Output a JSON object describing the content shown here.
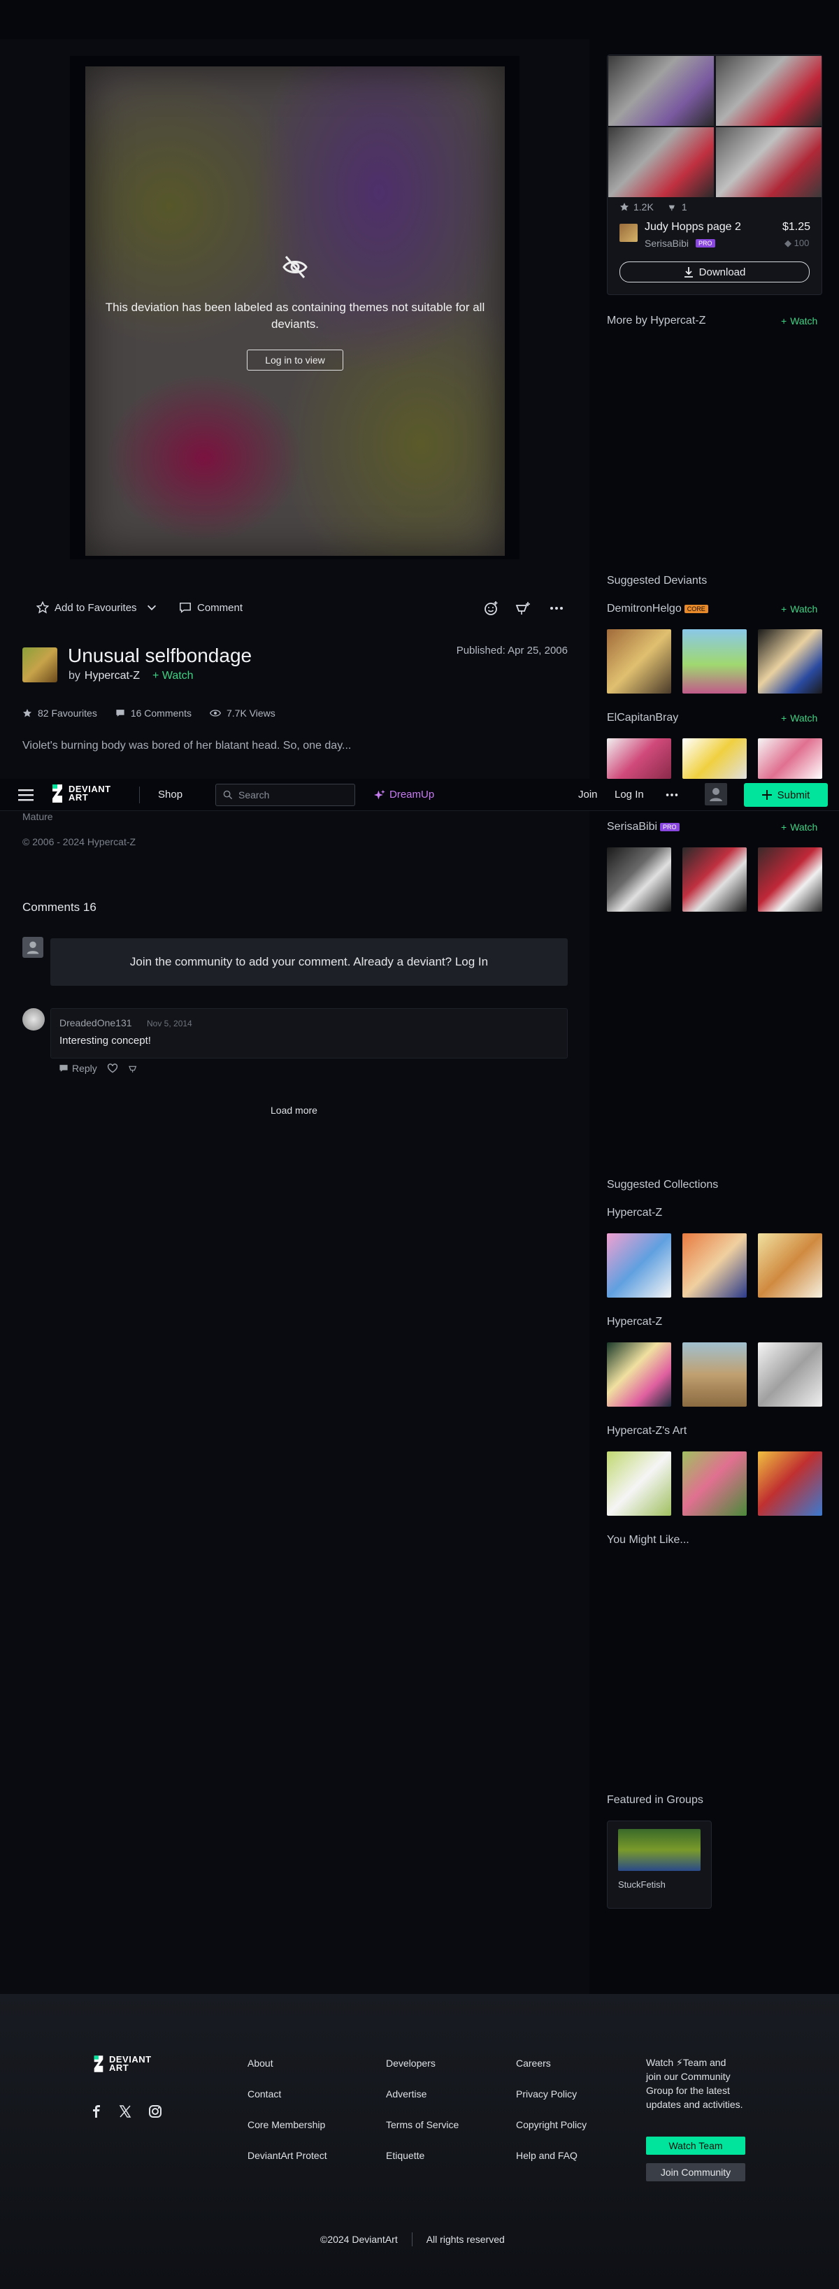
{
  "artwork": {
    "mature_message": "This deviation has been labeled as containing themes not suitable for all deviants.",
    "login_to_view": "Log in to view",
    "title": "Unusual selfbondage",
    "by_prefix": "by",
    "author": "Hypercat-Z",
    "watch_label": "Watch",
    "published": "Published: Apr 25, 2006",
    "favourites": "82 Favourites",
    "comments_count": "16 Comments",
    "views": "7.7K Views",
    "description": "Violet's burning body was bored of her blatant head. So, one day...",
    "mature_tag": "Mature",
    "copyright": "© 2006 - 2024 Hypercat-Z"
  },
  "actions": {
    "add_to_favourites": "Add to Favourites",
    "comment": "Comment"
  },
  "topbar": {
    "shop": "Shop",
    "search_placeholder": "Search",
    "dreamup": "DreamUp",
    "join": "Join",
    "login": "Log In",
    "submit": "Submit",
    "logo_line1": "DEVIANT",
    "logo_line2": "ART"
  },
  "comments": {
    "title": "Comments 16",
    "join_prompt": "Join the community to add your comment. Already a deviant? Log In",
    "items": [
      {
        "author": "DreadedOne131",
        "date": "Nov 5, 2014",
        "text": "Interesting concept!",
        "reply": "Reply"
      }
    ],
    "load_more": "Load more"
  },
  "promo": {
    "stars": "1.2K",
    "comments": "1",
    "title": "Judy Hopps page 2",
    "price": "$1.25",
    "author": "SerisaBibi",
    "count": "100",
    "download": "Download"
  },
  "rail": {
    "more_by": "More by Hypercat-Z",
    "watch": "Watch",
    "suggested_deviants": "Suggested Deviants",
    "deviants": [
      {
        "name": "DemitronHelgo",
        "badge": "CORE"
      },
      {
        "name": "ElCapitanBray",
        "badge": ""
      },
      {
        "name": "SerisaBibi",
        "badge": "PRO"
      }
    ],
    "suggested_collections": "Suggested Collections",
    "collections": [
      {
        "name": "Hypercat-Z"
      },
      {
        "name": "Hypercat-Z"
      },
      {
        "name": "Hypercat-Z's Art"
      }
    ],
    "you_might_like": "You Might Like...",
    "featured_groups": "Featured in Groups",
    "group_name": "StuckFetish"
  },
  "footer": {
    "logo_line1": "DEVIANT",
    "logo_line2": "ART",
    "col1": [
      "About",
      "Contact",
      "Core Membership",
      "DeviantArt Protect"
    ],
    "col2": [
      "Developers",
      "Advertise",
      "Terms of Service",
      "Etiquette"
    ],
    "col3": [
      "Careers",
      "Privacy Policy",
      "Copyright Policy",
      "Help and FAQ"
    ],
    "team_blurb": "Watch ⚡Team and join our Community Group for the latest updates and activities.",
    "watch_team": "Watch Team",
    "join_community": "Join Community",
    "copyright": "©2024 DeviantArt",
    "rights": "All rights reserved"
  },
  "colors": {
    "accent_green": "#00e59b",
    "watch_green": "#3fd384",
    "dreamup_purple": "#c77cf0",
    "background": "#06070d"
  }
}
